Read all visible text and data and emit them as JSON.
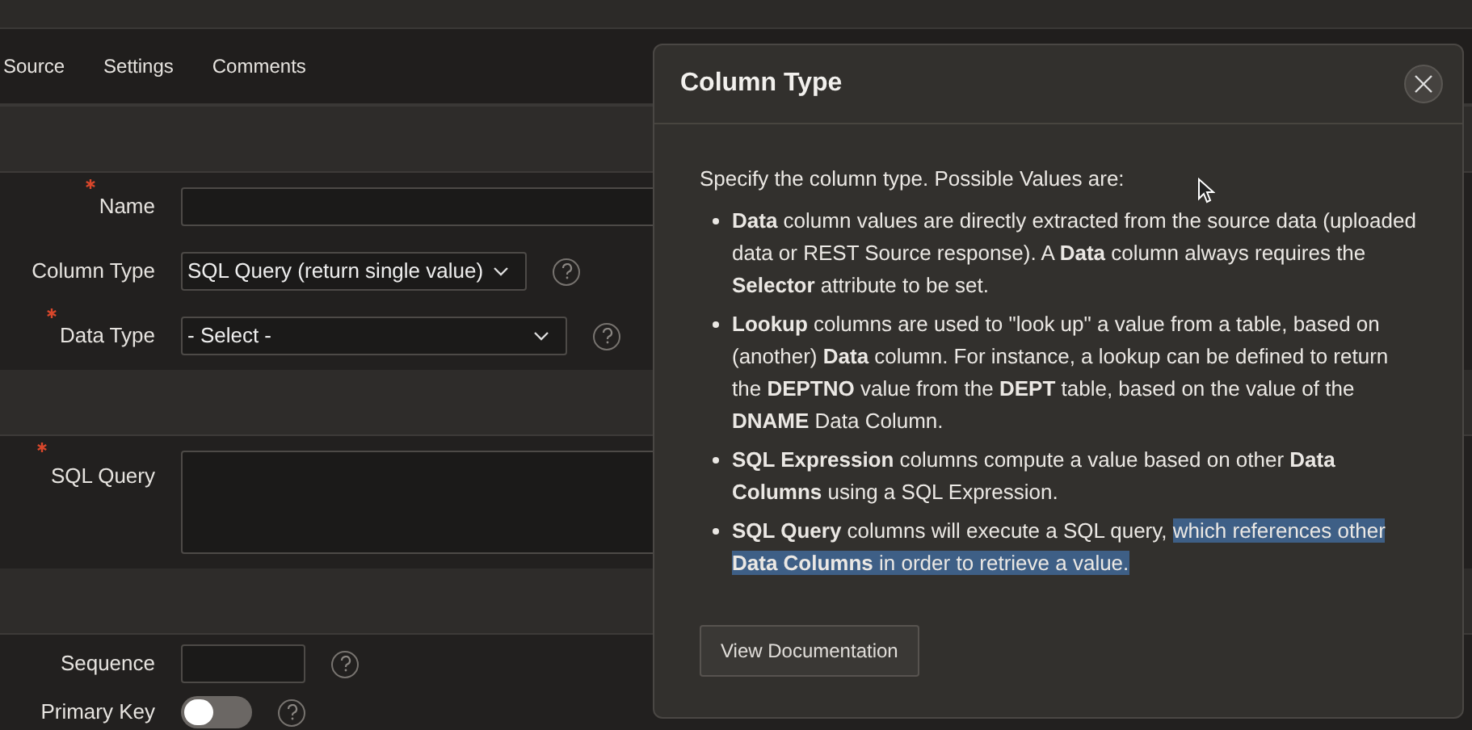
{
  "tabs": [
    {
      "label": "Source"
    },
    {
      "label": "Settings"
    },
    {
      "label": "Comments"
    }
  ],
  "form": {
    "groups": [
      {
        "fields": [
          {
            "kind": "input",
            "label": "Name",
            "required": true,
            "help": false
          },
          {
            "kind": "select",
            "label": "Column Type",
            "required": false,
            "value": "SQL Query (return single value)",
            "help": true,
            "wide": false
          },
          {
            "kind": "select",
            "label": "Data Type",
            "required": true,
            "value": "- Select -",
            "help": true,
            "wide": true
          }
        ]
      },
      {
        "fields": [
          {
            "kind": "textarea",
            "label": "SQL Query",
            "required": true,
            "help": false
          }
        ]
      },
      {
        "fields": [
          {
            "kind": "input",
            "label": "Sequence",
            "required": false,
            "help": true
          },
          {
            "kind": "switch",
            "label": "Primary Key",
            "required": false,
            "on": false,
            "help": true
          }
        ]
      }
    ]
  },
  "popup": {
    "title": "Column Type",
    "intro": "Specify the column type. Possible Values are:",
    "items": [
      [
        {
          "text": "Data",
          "bold": true,
          "highlighted": false
        },
        {
          "text": " column values are directly extracted from the source data (uploaded data or REST Source response). A ",
          "bold": false,
          "highlighted": false
        },
        {
          "text": "Data",
          "bold": true,
          "highlighted": false
        },
        {
          "text": " column always requires the ",
          "bold": false,
          "highlighted": false
        },
        {
          "text": "Selector",
          "bold": true,
          "highlighted": false
        },
        {
          "text": " attribute to be set.",
          "bold": false,
          "highlighted": false
        }
      ],
      [
        {
          "text": "Lookup",
          "bold": true,
          "highlighted": false
        },
        {
          "text": " columns are used to \"look up\" a value from a table, based on (another) ",
          "bold": false,
          "highlighted": false
        },
        {
          "text": "Data",
          "bold": true,
          "highlighted": false
        },
        {
          "text": " column. For instance, a lookup can be defined to return the ",
          "bold": false,
          "highlighted": false
        },
        {
          "text": "DEPTNO",
          "bold": true,
          "highlighted": false
        },
        {
          "text": " value from the ",
          "bold": false,
          "highlighted": false
        },
        {
          "text": "DEPT",
          "bold": true,
          "highlighted": false
        },
        {
          "text": " table, based on the value of the ",
          "bold": false,
          "highlighted": false
        },
        {
          "text": "DNAME",
          "bold": true,
          "highlighted": false
        },
        {
          "text": " Data Column.",
          "bold": false,
          "highlighted": false
        }
      ],
      [
        {
          "text": "SQL Expression",
          "bold": true,
          "highlighted": false
        },
        {
          "text": " columns compute a value based on other ",
          "bold": false,
          "highlighted": false
        },
        {
          "text": "Data Columns",
          "bold": true,
          "highlighted": false
        },
        {
          "text": " using a SQL Expression.",
          "bold": false,
          "highlighted": false
        }
      ],
      [
        {
          "text": "SQL Query",
          "bold": true,
          "highlighted": false
        },
        {
          "text": " columns will execute a SQL query, ",
          "bold": false,
          "highlighted": false
        },
        {
          "text": "which references other ",
          "bold": false,
          "highlighted": true
        },
        {
          "text": "Data Columns",
          "bold": true,
          "highlighted": true
        },
        {
          "text": " in order to retrieve a value.",
          "bold": false,
          "highlighted": true
        }
      ]
    ],
    "button": "View Documentation"
  }
}
